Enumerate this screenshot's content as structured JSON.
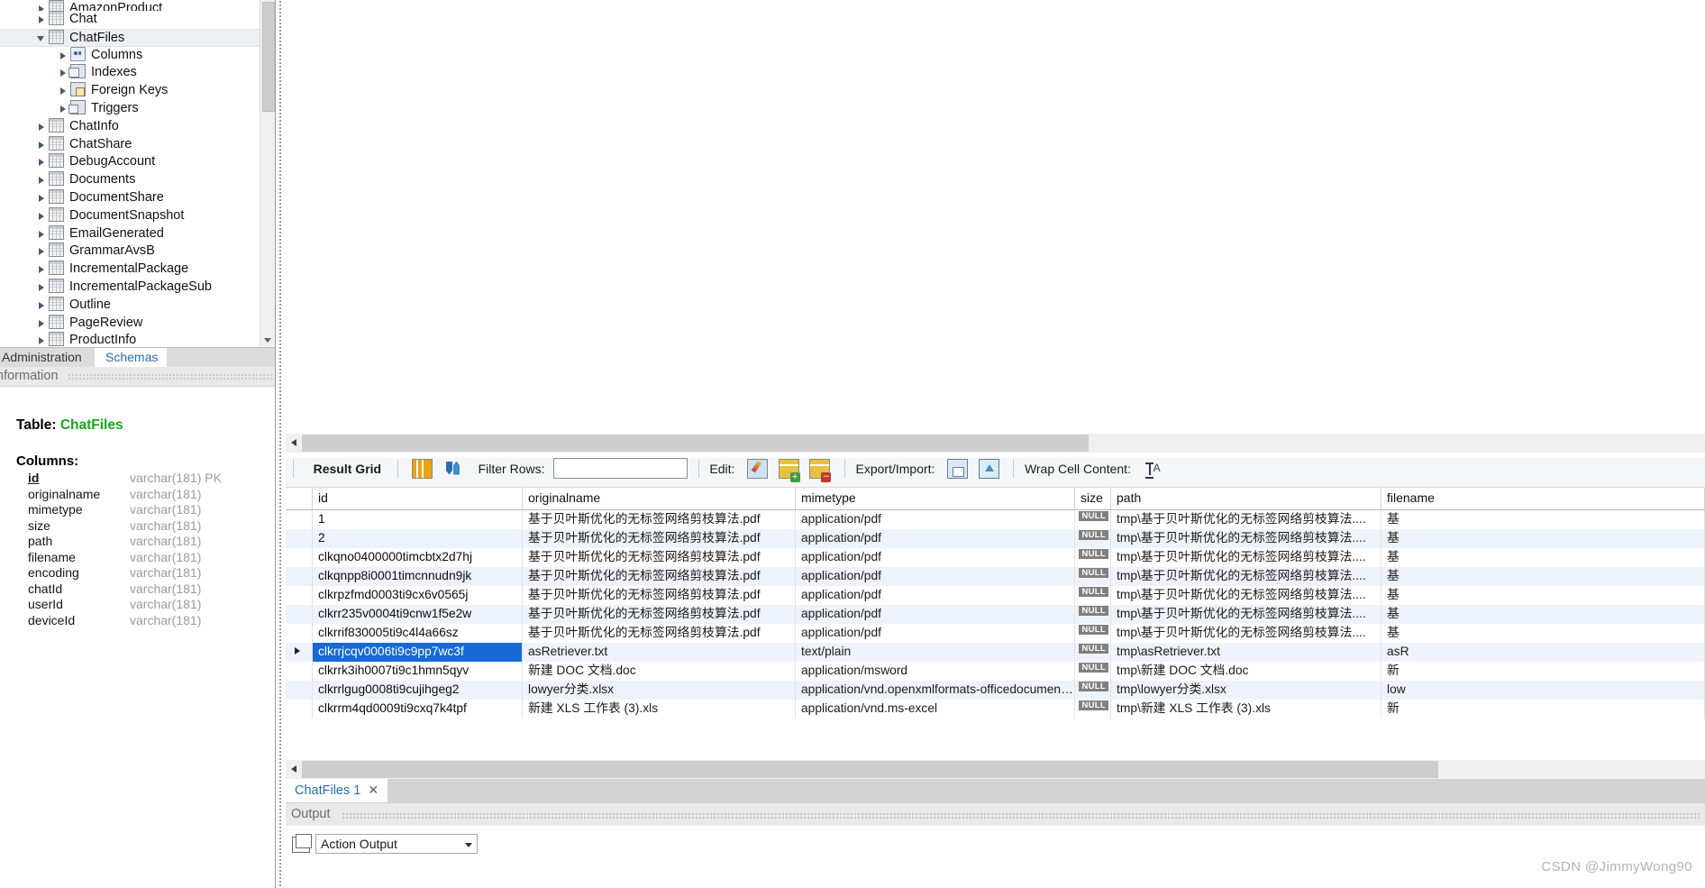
{
  "sidebar": {
    "tree": [
      {
        "label": "AmazonProduct",
        "level": 1,
        "expanded": false,
        "icon": "table-icon",
        "partial": true
      },
      {
        "label": "Chat",
        "level": 1,
        "expanded": false,
        "icon": "table-icon"
      },
      {
        "label": "ChatFiles",
        "level": 1,
        "expanded": true,
        "icon": "table-icon",
        "selected": true
      },
      {
        "label": "Columns",
        "level": 2,
        "expanded": false,
        "icon": "columns-icon"
      },
      {
        "label": "Indexes",
        "level": 2,
        "expanded": false,
        "icon": "indexes-icon"
      },
      {
        "label": "Foreign Keys",
        "level": 2,
        "expanded": false,
        "icon": "foreign-keys-icon"
      },
      {
        "label": "Triggers",
        "level": 2,
        "expanded": false,
        "icon": "triggers-icon"
      },
      {
        "label": "ChatInfo",
        "level": 1,
        "expanded": false,
        "icon": "table-icon"
      },
      {
        "label": "ChatShare",
        "level": 1,
        "expanded": false,
        "icon": "table-icon"
      },
      {
        "label": "DebugAccount",
        "level": 1,
        "expanded": false,
        "icon": "table-icon"
      },
      {
        "label": "Documents",
        "level": 1,
        "expanded": false,
        "icon": "table-icon"
      },
      {
        "label": "DocumentShare",
        "level": 1,
        "expanded": false,
        "icon": "table-icon"
      },
      {
        "label": "DocumentSnapshot",
        "level": 1,
        "expanded": false,
        "icon": "table-icon"
      },
      {
        "label": "EmailGenerated",
        "level": 1,
        "expanded": false,
        "icon": "table-icon"
      },
      {
        "label": "GrammarAvsB",
        "level": 1,
        "expanded": false,
        "icon": "table-icon"
      },
      {
        "label": "IncrementalPackage",
        "level": 1,
        "expanded": false,
        "icon": "table-icon"
      },
      {
        "label": "IncrementalPackageSub",
        "level": 1,
        "expanded": false,
        "icon": "table-icon"
      },
      {
        "label": "Outline",
        "level": 1,
        "expanded": false,
        "icon": "table-icon"
      },
      {
        "label": "PageReview",
        "level": 1,
        "expanded": false,
        "icon": "table-icon"
      },
      {
        "label": "ProductInfo",
        "level": 1,
        "expanded": false,
        "icon": "table-icon"
      }
    ],
    "tabs": [
      {
        "label": "Administration",
        "active": false
      },
      {
        "label": "Schemas",
        "active": true
      }
    ],
    "info_panel": {
      "header": "Information",
      "table_label": "Table:",
      "table_name": "ChatFiles",
      "columns_label": "Columns:",
      "columns": [
        {
          "name": "id",
          "type": "varchar(181) PK",
          "pk": true
        },
        {
          "name": "originalname",
          "type": "varchar(181)",
          "pk": false
        },
        {
          "name": "mimetype",
          "type": "varchar(181)",
          "pk": false
        },
        {
          "name": "size",
          "type": "varchar(181)",
          "pk": false
        },
        {
          "name": "path",
          "type": "varchar(181)",
          "pk": false
        },
        {
          "name": "filename",
          "type": "varchar(181)",
          "pk": false
        },
        {
          "name": "encoding",
          "type": "varchar(181)",
          "pk": false
        },
        {
          "name": "chatId",
          "type": "varchar(181)",
          "pk": false
        },
        {
          "name": "userId",
          "type": "varchar(181)",
          "pk": false
        },
        {
          "name": "deviceId",
          "type": "varchar(181)",
          "pk": false
        }
      ]
    }
  },
  "result_toolbar": {
    "result_grid_label": "Result Grid",
    "grid_toggle_icon": "grid-layout-icon",
    "refresh_icon": "refresh-icon",
    "filter_rows_label": "Filter Rows:",
    "filter_value": "",
    "filter_placeholder": "",
    "edit_label": "Edit:",
    "edit_icon": "pencil-edit-icon",
    "insert_row_icon": "insert-row-icon",
    "delete_row_icon": "delete-row-icon",
    "export_import_label": "Export/Import:",
    "export_icon": "export-recordset-icon",
    "import_icon": "import-recordset-icon",
    "wrap_cell_label": "Wrap Cell Content:",
    "wrap_cell_icon": "wrap-cell-icon"
  },
  "grid": {
    "columns": [
      "id",
      "originalname",
      "mimetype",
      "size",
      "path",
      "filename"
    ],
    "rows": [
      {
        "id": "1",
        "originalname": "基于贝叶斯优化的无标签网络剪枝算法.pdf",
        "mimetype": "application/pdf",
        "size": "NULL",
        "path": "tmp\\基于贝叶斯优化的无标签网络剪枝算法....",
        "filename": "基",
        "selected": false
      },
      {
        "id": "2",
        "originalname": "基于贝叶斯优化的无标签网络剪枝算法.pdf",
        "mimetype": "application/pdf",
        "size": "NULL",
        "path": "tmp\\基于贝叶斯优化的无标签网络剪枝算法....",
        "filename": "基",
        "selected": false
      },
      {
        "id": "clkqno0400000timcbtx2d7hj",
        "originalname": "基于贝叶斯优化的无标签网络剪枝算法.pdf",
        "mimetype": "application/pdf",
        "size": "NULL",
        "path": "tmp\\基于贝叶斯优化的无标签网络剪枝算法....",
        "filename": "基",
        "selected": false
      },
      {
        "id": "clkqnpp8i0001timcnnudn9jk",
        "originalname": "基于贝叶斯优化的无标签网络剪枝算法.pdf",
        "mimetype": "application/pdf",
        "size": "NULL",
        "path": "tmp\\基于贝叶斯优化的无标签网络剪枝算法....",
        "filename": "基",
        "selected": false
      },
      {
        "id": "clkrpzfmd0003ti9cx6v0565j",
        "originalname": "基于贝叶斯优化的无标签网络剪枝算法.pdf",
        "mimetype": "application/pdf",
        "size": "NULL",
        "path": "tmp\\基于贝叶斯优化的无标签网络剪枝算法....",
        "filename": "基",
        "selected": false
      },
      {
        "id": "clkrr235v0004ti9cnw1f5e2w",
        "originalname": "基于贝叶斯优化的无标签网络剪枝算法.pdf",
        "mimetype": "application/pdf",
        "size": "NULL",
        "path": "tmp\\基于贝叶斯优化的无标签网络剪枝算法....",
        "filename": "基",
        "selected": false
      },
      {
        "id": "clkrrif830005ti9c4l4a66sz",
        "originalname": "基于贝叶斯优化的无标签网络剪枝算法.pdf",
        "mimetype": "application/pdf",
        "size": "NULL",
        "path": "tmp\\基于贝叶斯优化的无标签网络剪枝算法....",
        "filename": "基",
        "selected": false
      },
      {
        "id": "clkrrjcqv0006ti9c9pp7wc3f",
        "originalname": "asRetriever.txt",
        "mimetype": "text/plain",
        "size": "NULL",
        "path": "tmp\\asRetriever.txt",
        "filename": "asR",
        "selected": true
      },
      {
        "id": "clkrrk3ih0007ti9c1hmn5qyv",
        "originalname": "新建 DOC 文档.doc",
        "mimetype": "application/msword",
        "size": "NULL",
        "path": "tmp\\新建 DOC 文档.doc",
        "filename": "新",
        "selected": false
      },
      {
        "id": "clkrrlgug0008ti9cujihgeg2",
        "originalname": "lowyer分类.xlsx",
        "mimetype": "application/vnd.openxmlformats-officedocumen…",
        "size": "NULL",
        "path": "tmp\\lowyer分类.xlsx",
        "filename": "low",
        "selected": false
      },
      {
        "id": "clkrrm4qd0009ti9cxq7k4tpf",
        "originalname": "新建 XLS 工作表 (3).xls",
        "mimetype": "application/vnd.ms-excel",
        "size": "NULL",
        "path": "tmp\\新建 XLS 工作表 (3).xls",
        "filename": "新",
        "selected": false
      }
    ]
  },
  "result_tabs": [
    {
      "label": "ChatFiles 1",
      "close": "✕",
      "active": true
    }
  ],
  "output": {
    "header": "Output",
    "selected_mode": "Action Output",
    "mode_icon": "output-pane-icon"
  },
  "watermark": "CSDN @JimmyWong90"
}
